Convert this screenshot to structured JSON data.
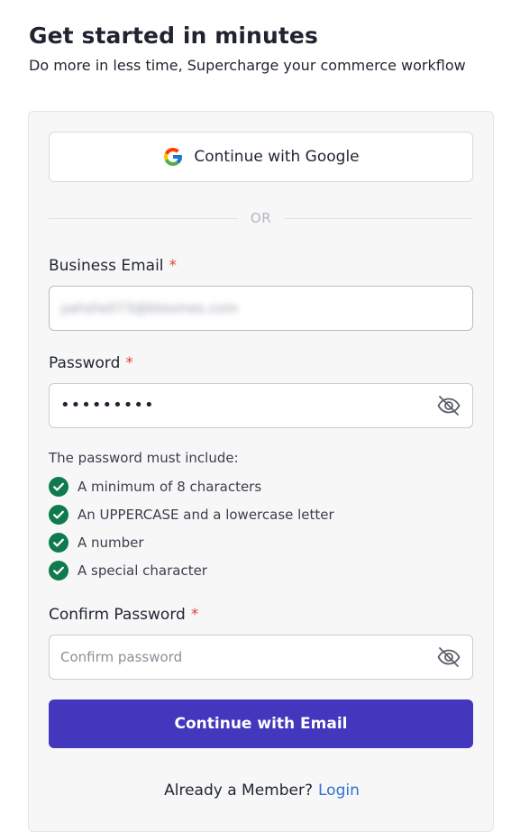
{
  "header": {
    "title": "Get started in minutes",
    "subtitle": "Do more in less time, Supercharge your commerce workflow"
  },
  "google": {
    "label": "Continue with Google",
    "icon": "google-icon"
  },
  "divider": {
    "text": "OR"
  },
  "email": {
    "label": "Business Email",
    "required_mark": "*",
    "value": "yahshell73@bloomes.com"
  },
  "password": {
    "label": "Password",
    "required_mark": "*",
    "value": "•••••••••",
    "toggle_icon": "eye-off-icon"
  },
  "requirements": {
    "title": "The password must include:",
    "items": [
      {
        "text": "A minimum of 8 characters",
        "met": true
      },
      {
        "text": "An UPPERCASE and a lowercase letter",
        "met": true
      },
      {
        "text": "A number",
        "met": true
      },
      {
        "text": "A special character",
        "met": true
      }
    ],
    "check_color": "#0f7a4d"
  },
  "confirm": {
    "label": "Confirm Password",
    "required_mark": "*",
    "placeholder": "Confirm password",
    "toggle_icon": "eye-off-icon"
  },
  "submit": {
    "label": "Continue with Email",
    "color": "#4237bd"
  },
  "footer": {
    "prompt": "Already a Member?",
    "link": "Login"
  }
}
